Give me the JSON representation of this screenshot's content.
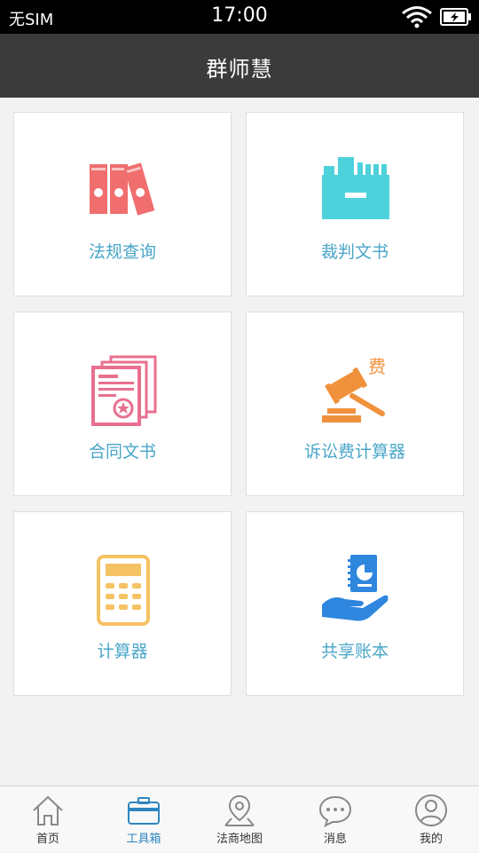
{
  "status_bar": {
    "carrier": "无SIM",
    "time": "17:00"
  },
  "header": {
    "title": "群师慧"
  },
  "tiles": [
    {
      "label": "法规查询",
      "icon": "binders-icon",
      "color": "#f06e6e"
    },
    {
      "label": "裁判文书",
      "icon": "filebox-icon",
      "color": "#4dd2dc"
    },
    {
      "label": "合同文书",
      "icon": "contract-icon",
      "color": "#e8708f"
    },
    {
      "label": "诉讼费计算器",
      "icon": "gavel-icon",
      "color": "#f0913c",
      "icon_text": "费"
    },
    {
      "label": "计算器",
      "icon": "calculator-icon",
      "color": "#f5c264"
    },
    {
      "label": "共享账本",
      "icon": "ledger-icon",
      "color": "#2e86de"
    }
  ],
  "tabbar": {
    "items": [
      {
        "label": "首页",
        "icon": "home-icon"
      },
      {
        "label": "工具箱",
        "icon": "toolbox-icon",
        "active": true
      },
      {
        "label": "法商地图",
        "icon": "map-pin-icon"
      },
      {
        "label": "消息",
        "icon": "chat-bubble-icon"
      },
      {
        "label": "我的",
        "icon": "user-icon"
      }
    ],
    "active_color": "#2e86c1"
  }
}
